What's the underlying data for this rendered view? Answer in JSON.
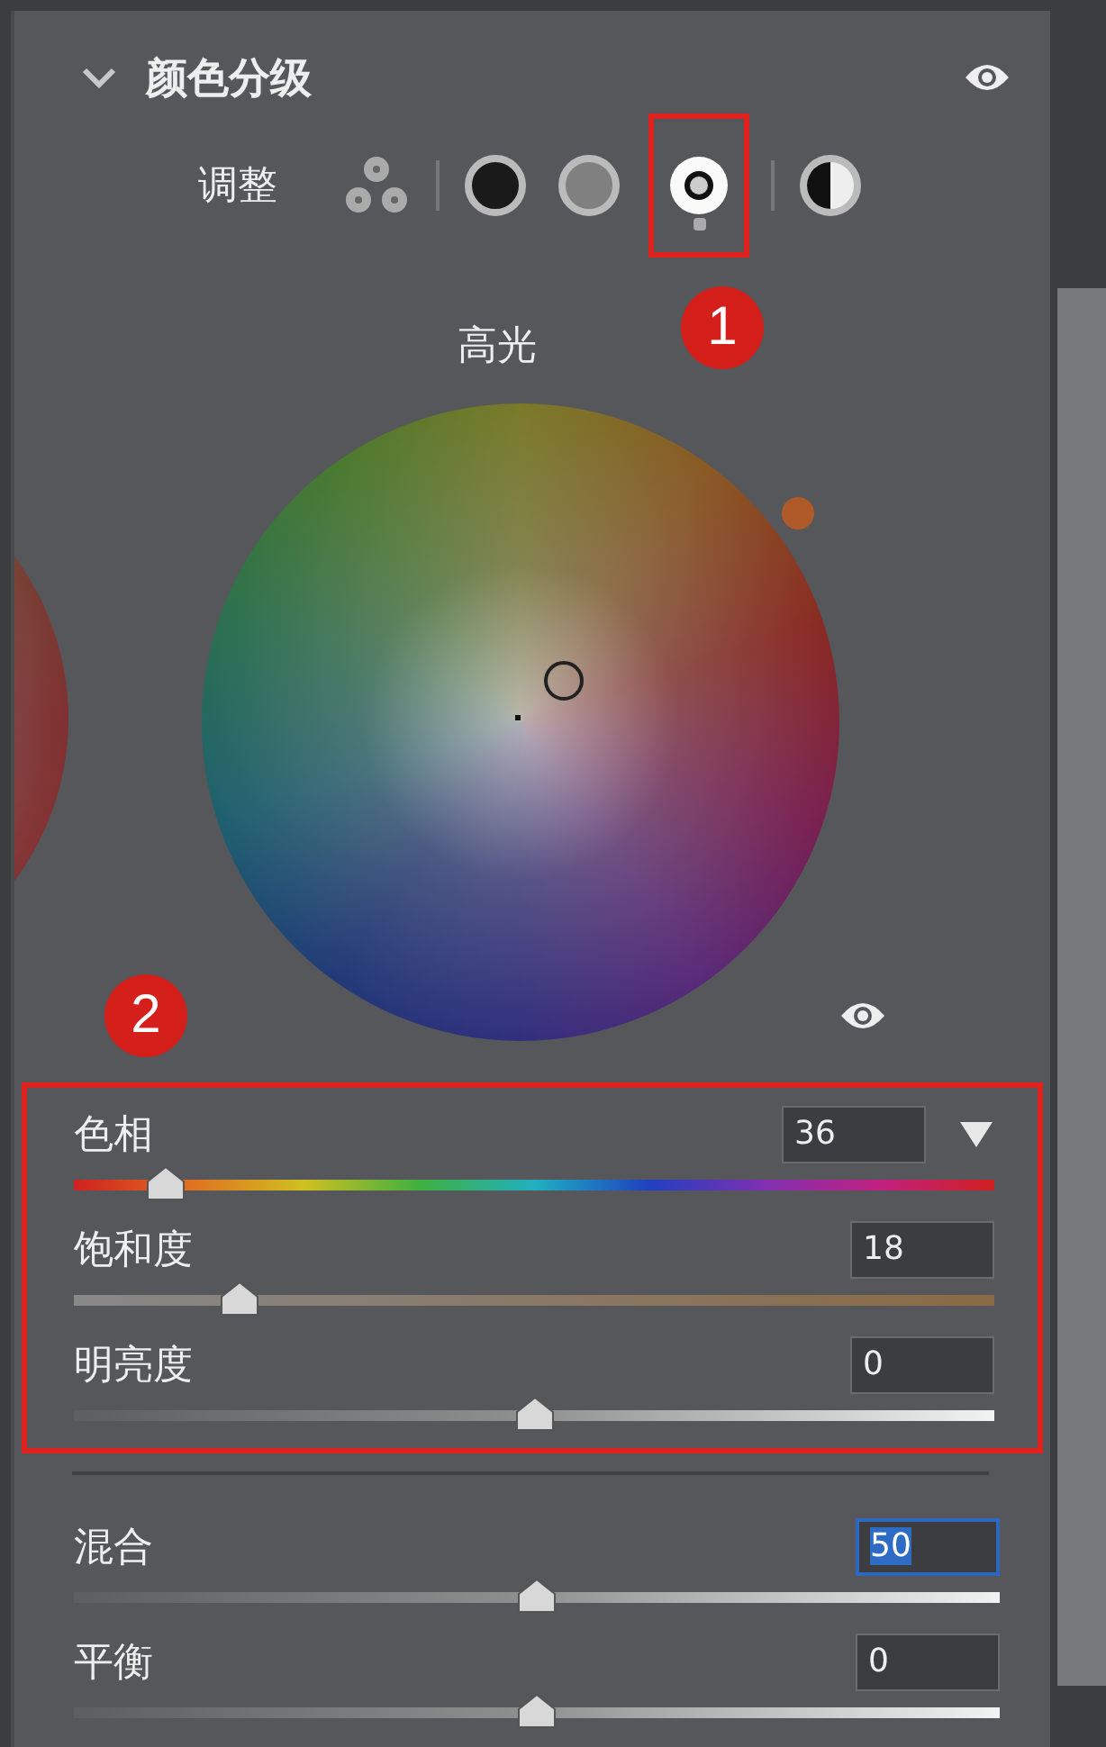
{
  "section": {
    "title": "颜色分级",
    "expanded": true,
    "visible": true
  },
  "adjust": {
    "label": "调整",
    "modes": [
      {
        "kind": "all",
        "selected": false
      },
      {
        "kind": "shadows",
        "selected": false
      },
      {
        "kind": "midtones",
        "selected": false
      },
      {
        "kind": "highlights",
        "selected": true
      },
      {
        "kind": "global",
        "selected": false
      }
    ]
  },
  "wheel": {
    "label": "高光",
    "visible": true
  },
  "callouts": [
    "1",
    "2"
  ],
  "color_sliders": [
    {
      "kind": "hue",
      "label": "色相",
      "value": "36",
      "level": 0.1,
      "focused": false
    },
    {
      "kind": "saturation",
      "label": "饱和度",
      "value": "18",
      "level": 0.18,
      "focused": false
    },
    {
      "kind": "brightness",
      "label": "明亮度",
      "value": "0",
      "level": 0.5,
      "focused": false
    }
  ],
  "blend_sliders": [
    {
      "kind": "neutral",
      "label": "混合",
      "value": "50",
      "level": 0.5,
      "focused": true
    },
    {
      "kind": "neutral",
      "label": "平衡",
      "value": "0",
      "level": 0.5,
      "focused": false
    }
  ]
}
